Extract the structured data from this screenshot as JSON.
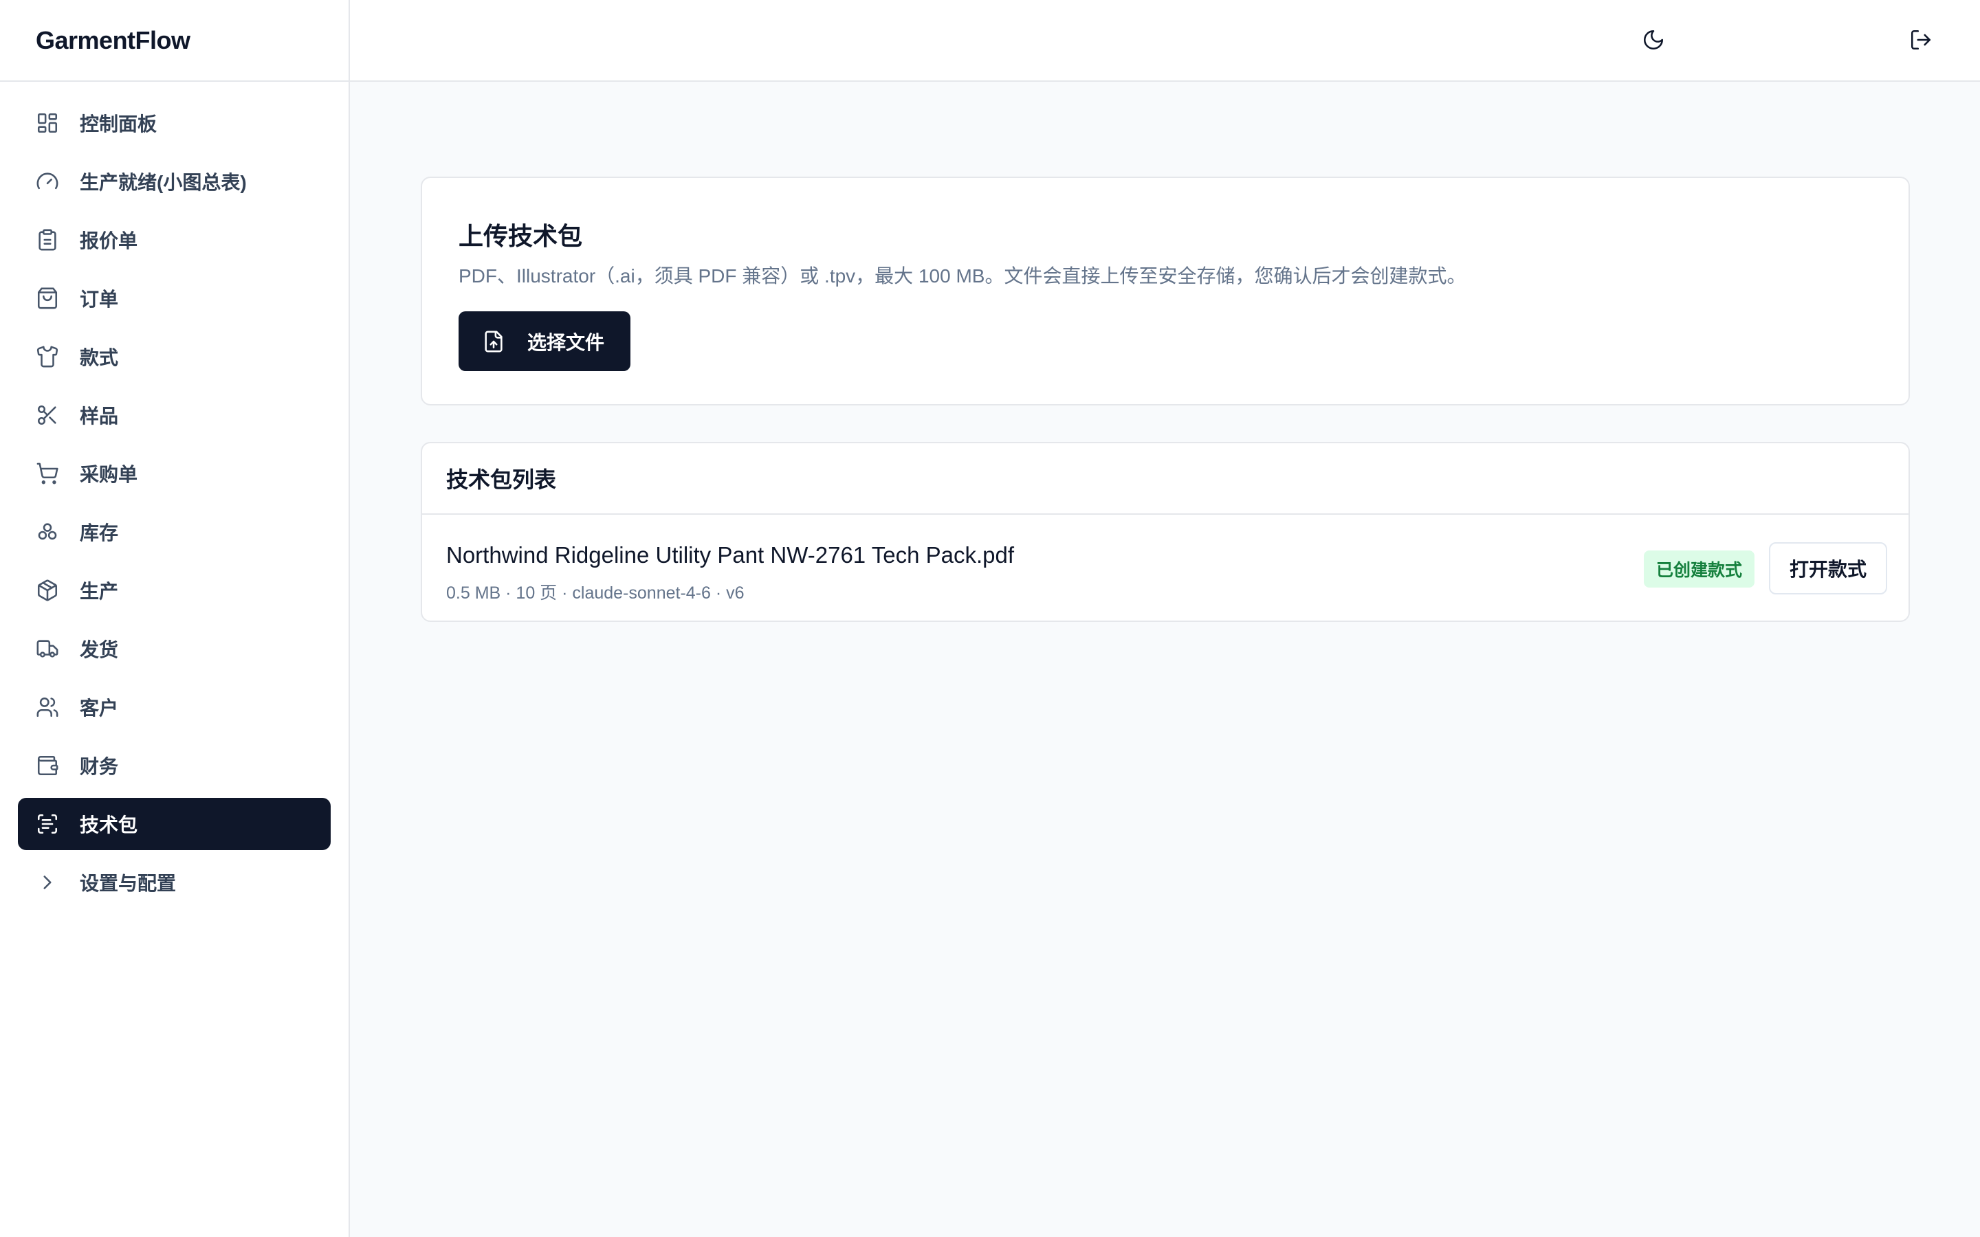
{
  "app": {
    "brand": "GarmentFlow"
  },
  "sidebar": {
    "items": [
      {
        "label": "控制面板",
        "icon": "dashboard-grid-icon"
      },
      {
        "label": "生产就绪(小图总表)",
        "icon": "gauge-icon"
      },
      {
        "label": "报价单",
        "icon": "clipboard-icon"
      },
      {
        "label": "订单",
        "icon": "shopping-bag-icon"
      },
      {
        "label": "款式",
        "icon": "shirt-icon"
      },
      {
        "label": "样品",
        "icon": "scissors-icon"
      },
      {
        "label": "采购单",
        "icon": "shopping-cart-icon"
      },
      {
        "label": "库存",
        "icon": "boxes-icon"
      },
      {
        "label": "生产",
        "icon": "package-icon"
      },
      {
        "label": "发货",
        "icon": "truck-icon"
      },
      {
        "label": "客户",
        "icon": "users-icon"
      },
      {
        "label": "财务",
        "icon": "wallet-icon"
      },
      {
        "label": "技术包",
        "icon": "scan-text-icon",
        "active": true
      },
      {
        "label": "设置与配置",
        "icon": "chevron-right-icon"
      }
    ]
  },
  "topbar": {
    "theme_icon": "moon-icon",
    "logout_icon": "log-out-icon"
  },
  "upload": {
    "title": "上传技术包",
    "description": "PDF、Illustrator（.ai，须具 PDF 兼容）或 .tpv，最大 100 MB。文件会直接上传至安全存储，您确认后才会创建款式。",
    "button_label": "选择文件",
    "button_icon": "file-upload-icon"
  },
  "list": {
    "title": "技术包列表",
    "rows": [
      {
        "file_name": "Northwind Ridgeline Utility Pant NW-2761 Tech Pack.pdf",
        "meta": "0.5 MB · 10 页 · claude-sonnet-4-6 · v6",
        "status": "已创建款式",
        "action": "打开款式"
      }
    ]
  },
  "colors": {
    "primary": "#0f172a",
    "background": "#f8fafc",
    "muted_text": "#64748b",
    "success_bg": "#dcfce7",
    "success_text": "#15803d",
    "border": "#e5e7eb"
  }
}
